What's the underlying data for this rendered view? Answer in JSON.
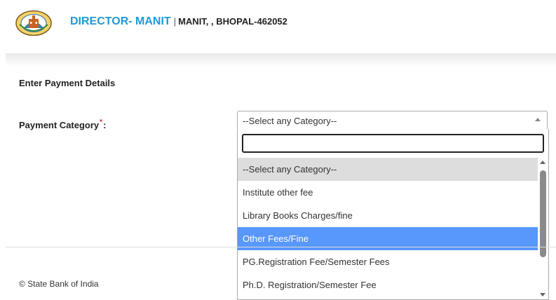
{
  "header": {
    "logo_icon": "manit-emblem-icon",
    "title": "DIRECTOR- MANIT",
    "separator": "|",
    "address": "MANIT, , BHOPAL-462052"
  },
  "form": {
    "section_title": "Enter Payment Details",
    "payment_category_label": "Payment Category",
    "required_marker": "*",
    "colon": ":",
    "selected_value": "--Select any Category--",
    "search_value": "",
    "options": [
      "--Select any Category--",
      "Institute other fee",
      "Library Books Charges/fine",
      "Other Fees/Fine",
      "PG.Registration Fee/Semester Fees",
      "Ph.D. Registration/Semester Fee"
    ],
    "current_option": "--Select any Category--",
    "highlighted_option": "Other Fees/Fine"
  },
  "footer": {
    "copyright": "© State Bank of India"
  },
  "colors": {
    "brand": "#1f9ad6",
    "highlight": "#5897fb",
    "current_option_bg": "#dddddd"
  }
}
